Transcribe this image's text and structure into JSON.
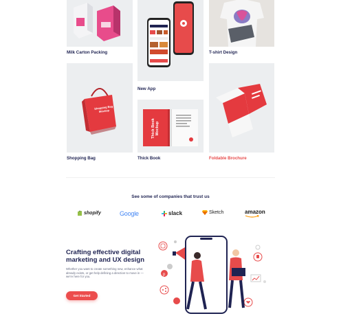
{
  "portfolio": {
    "items": [
      {
        "label": "Milk Carton Packing"
      },
      {
        "label": "New  App"
      },
      {
        "label": "T-shirt Design"
      },
      {
        "label": "Shopping Bag",
        "mockup_text": "Shopping Bag Mockup"
      },
      {
        "label": "Thick Book",
        "mockup_text": "Thick Book Mockup"
      },
      {
        "label": "Foldable Brochure"
      }
    ]
  },
  "trust": {
    "heading": "See some of companies that trust us",
    "logos": [
      "shopify",
      "Google",
      "slack",
      "Sketch",
      "amazon"
    ]
  },
  "hero": {
    "title": "Crafting effective digital marketing and UX design",
    "body": "Whether you want to create something new, enhance what already exists, or get help defining a direction to move in — we're here for you.",
    "cta_label": "Get Started"
  },
  "colors": {
    "accent": "#e74b4b",
    "navy": "#1f2352",
    "card_bg": "#eceef0"
  }
}
